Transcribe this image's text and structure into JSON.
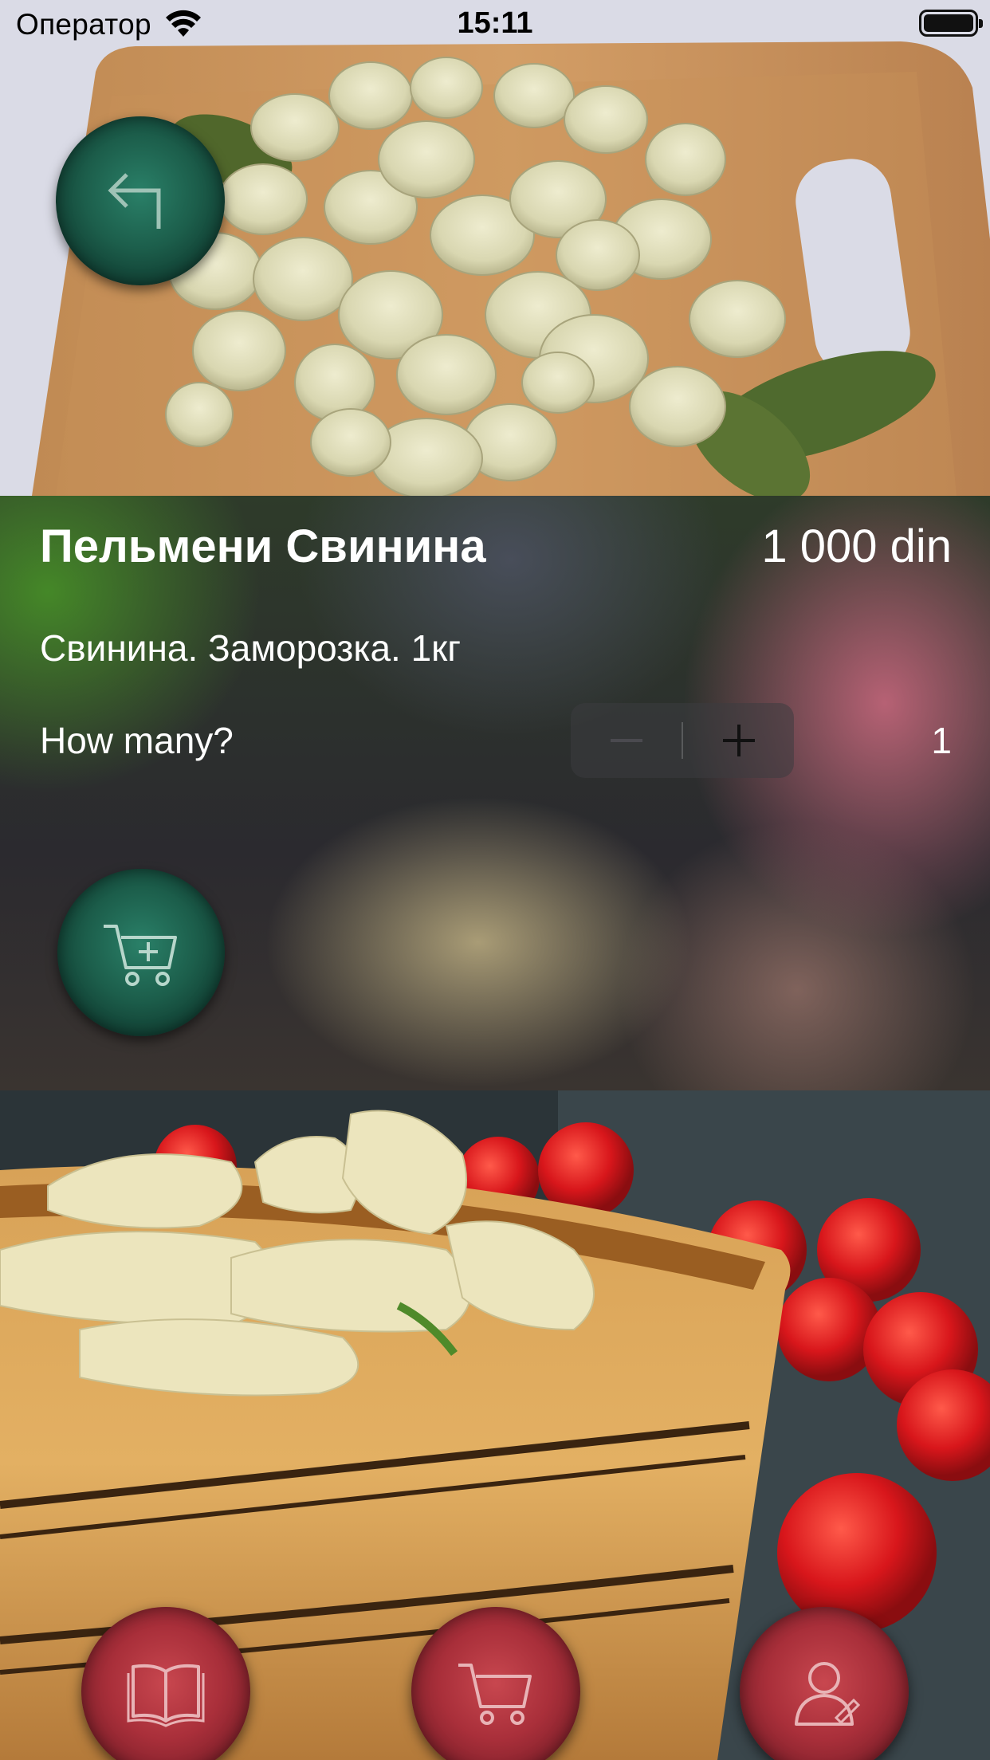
{
  "status_bar": {
    "carrier": "Оператор",
    "time": "15:11",
    "wifi_icon": "wifi-icon",
    "battery_icon": "battery-icon"
  },
  "product": {
    "title": "Пельмени Свинина",
    "price": "1 000 din",
    "description": "Свинина. Заморозка. 1кг",
    "hero_image": "photo of raw dumplings on wooden cutting board",
    "bottom_image": "photo of boiled dumplings in wooden bowl with cherry tomatoes"
  },
  "quantity": {
    "label": "How many?",
    "value": "1",
    "decrement_icon": "minus-icon",
    "increment_icon": "plus-icon"
  },
  "actions": {
    "back_icon": "back-arrow-icon",
    "add_to_cart_icon": "cart-plus-icon"
  },
  "tab_bar": {
    "items": [
      {
        "id": "menu",
        "icon": "book-icon"
      },
      {
        "id": "cart",
        "icon": "cart-icon"
      },
      {
        "id": "profile",
        "icon": "user-icon"
      }
    ]
  },
  "colors": {
    "green_button": "#1c5e4b",
    "red_button": "#a92f3a",
    "text": "#ffffff"
  }
}
